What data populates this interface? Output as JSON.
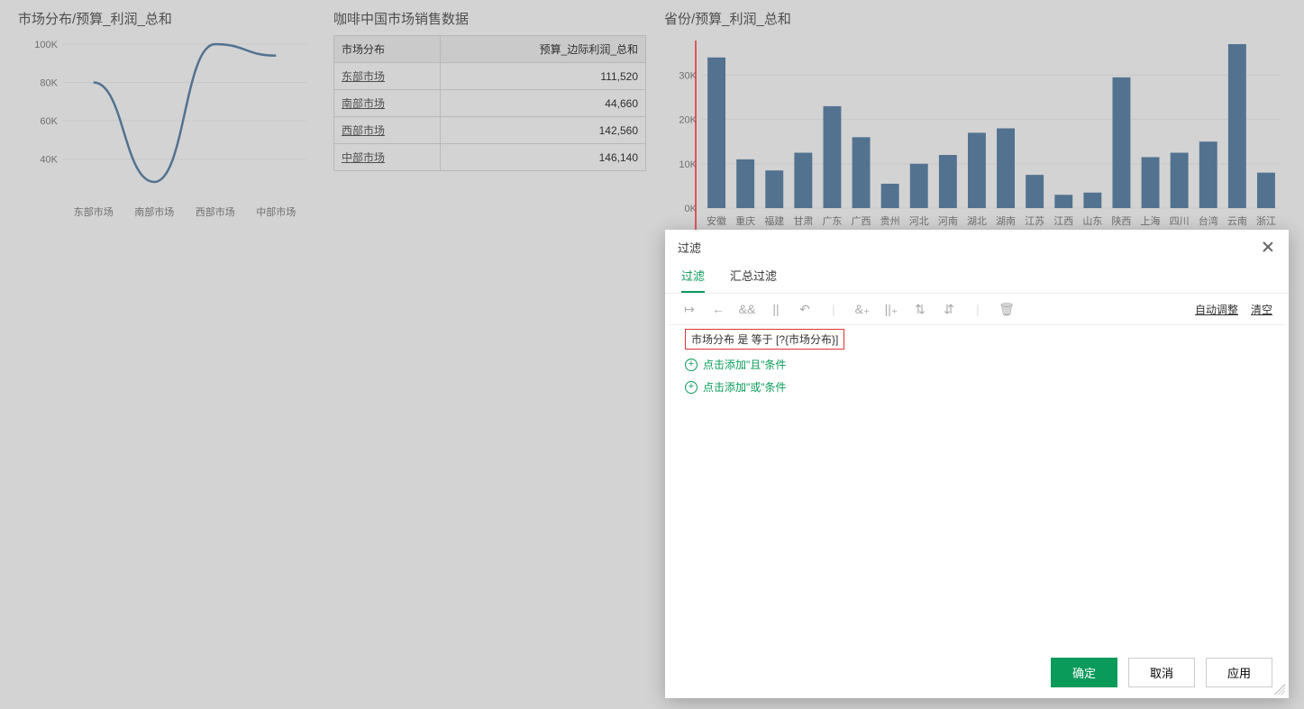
{
  "linechart": {
    "title": "市场分布/预算_利润_总和"
  },
  "table": {
    "title": "咖啡中国市场销售数据",
    "col1": "市场分布",
    "col2": "预算_边际利润_总和",
    "rows": [
      {
        "name": "东部市场",
        "value": "111,520"
      },
      {
        "name": "南部市场",
        "value": "44,660"
      },
      {
        "name": "西部市场",
        "value": "142,560"
      },
      {
        "name": "中部市场",
        "value": "146,140"
      }
    ]
  },
  "barchart": {
    "title": "省份/预算_利润_总和"
  },
  "dialog": {
    "title": "过滤",
    "tab1": "过滤",
    "tab2": "汇总过滤",
    "auto_adjust": "自动调整",
    "clear": "清空",
    "condition": "市场分布 是 等于 [?{市场分布}]",
    "add_and": "点击添加\"且\"条件",
    "add_or": "点击添加\"或\"条件",
    "confirm": "确定",
    "cancel": "取消",
    "apply": "应用"
  },
  "chart_data": [
    {
      "type": "line",
      "title": "市场分布/预算_利润_总和",
      "categories": [
        "东部市场",
        "南部市场",
        "西部市场",
        "中部市场"
      ],
      "values": [
        80000,
        28000,
        100000,
        94000
      ],
      "ylabel": "",
      "xlabel": "",
      "ylim": [
        0,
        100000
      ],
      "yticks": [
        40000,
        60000,
        80000,
        100000
      ],
      "ytick_labels": [
        "40K",
        "60K",
        "80K",
        "100K"
      ]
    },
    {
      "type": "table",
      "title": "咖啡中国市场销售数据",
      "columns": [
        "市场分布",
        "预算_边际利润_总和"
      ],
      "rows": [
        [
          "东部市场",
          111520
        ],
        [
          "南部市场",
          44660
        ],
        [
          "西部市场",
          142560
        ],
        [
          "中部市场",
          146140
        ]
      ]
    },
    {
      "type": "bar",
      "title": "省份/预算_利润_总和",
      "categories": [
        "安徽",
        "重庆",
        "福建",
        "甘肃",
        "广东",
        "广西",
        "贵州",
        "河北",
        "河南",
        "湖北",
        "湖南",
        "江苏",
        "江西",
        "山东",
        "陕西",
        "上海",
        "四川",
        "台湾",
        "云南",
        "浙江"
      ],
      "values": [
        34000,
        11000,
        8500,
        12500,
        23000,
        16000,
        5500,
        10000,
        12000,
        17000,
        18000,
        7500,
        3000,
        3500,
        29500,
        11500,
        12500,
        15000,
        37000,
        8000
      ],
      "ylabel": "",
      "xlabel": "",
      "ylim": [
        0,
        37000
      ],
      "yticks": [
        0,
        10000,
        20000,
        30000
      ],
      "ytick_labels": [
        "0K",
        "10K",
        "20K",
        "30K"
      ]
    }
  ]
}
